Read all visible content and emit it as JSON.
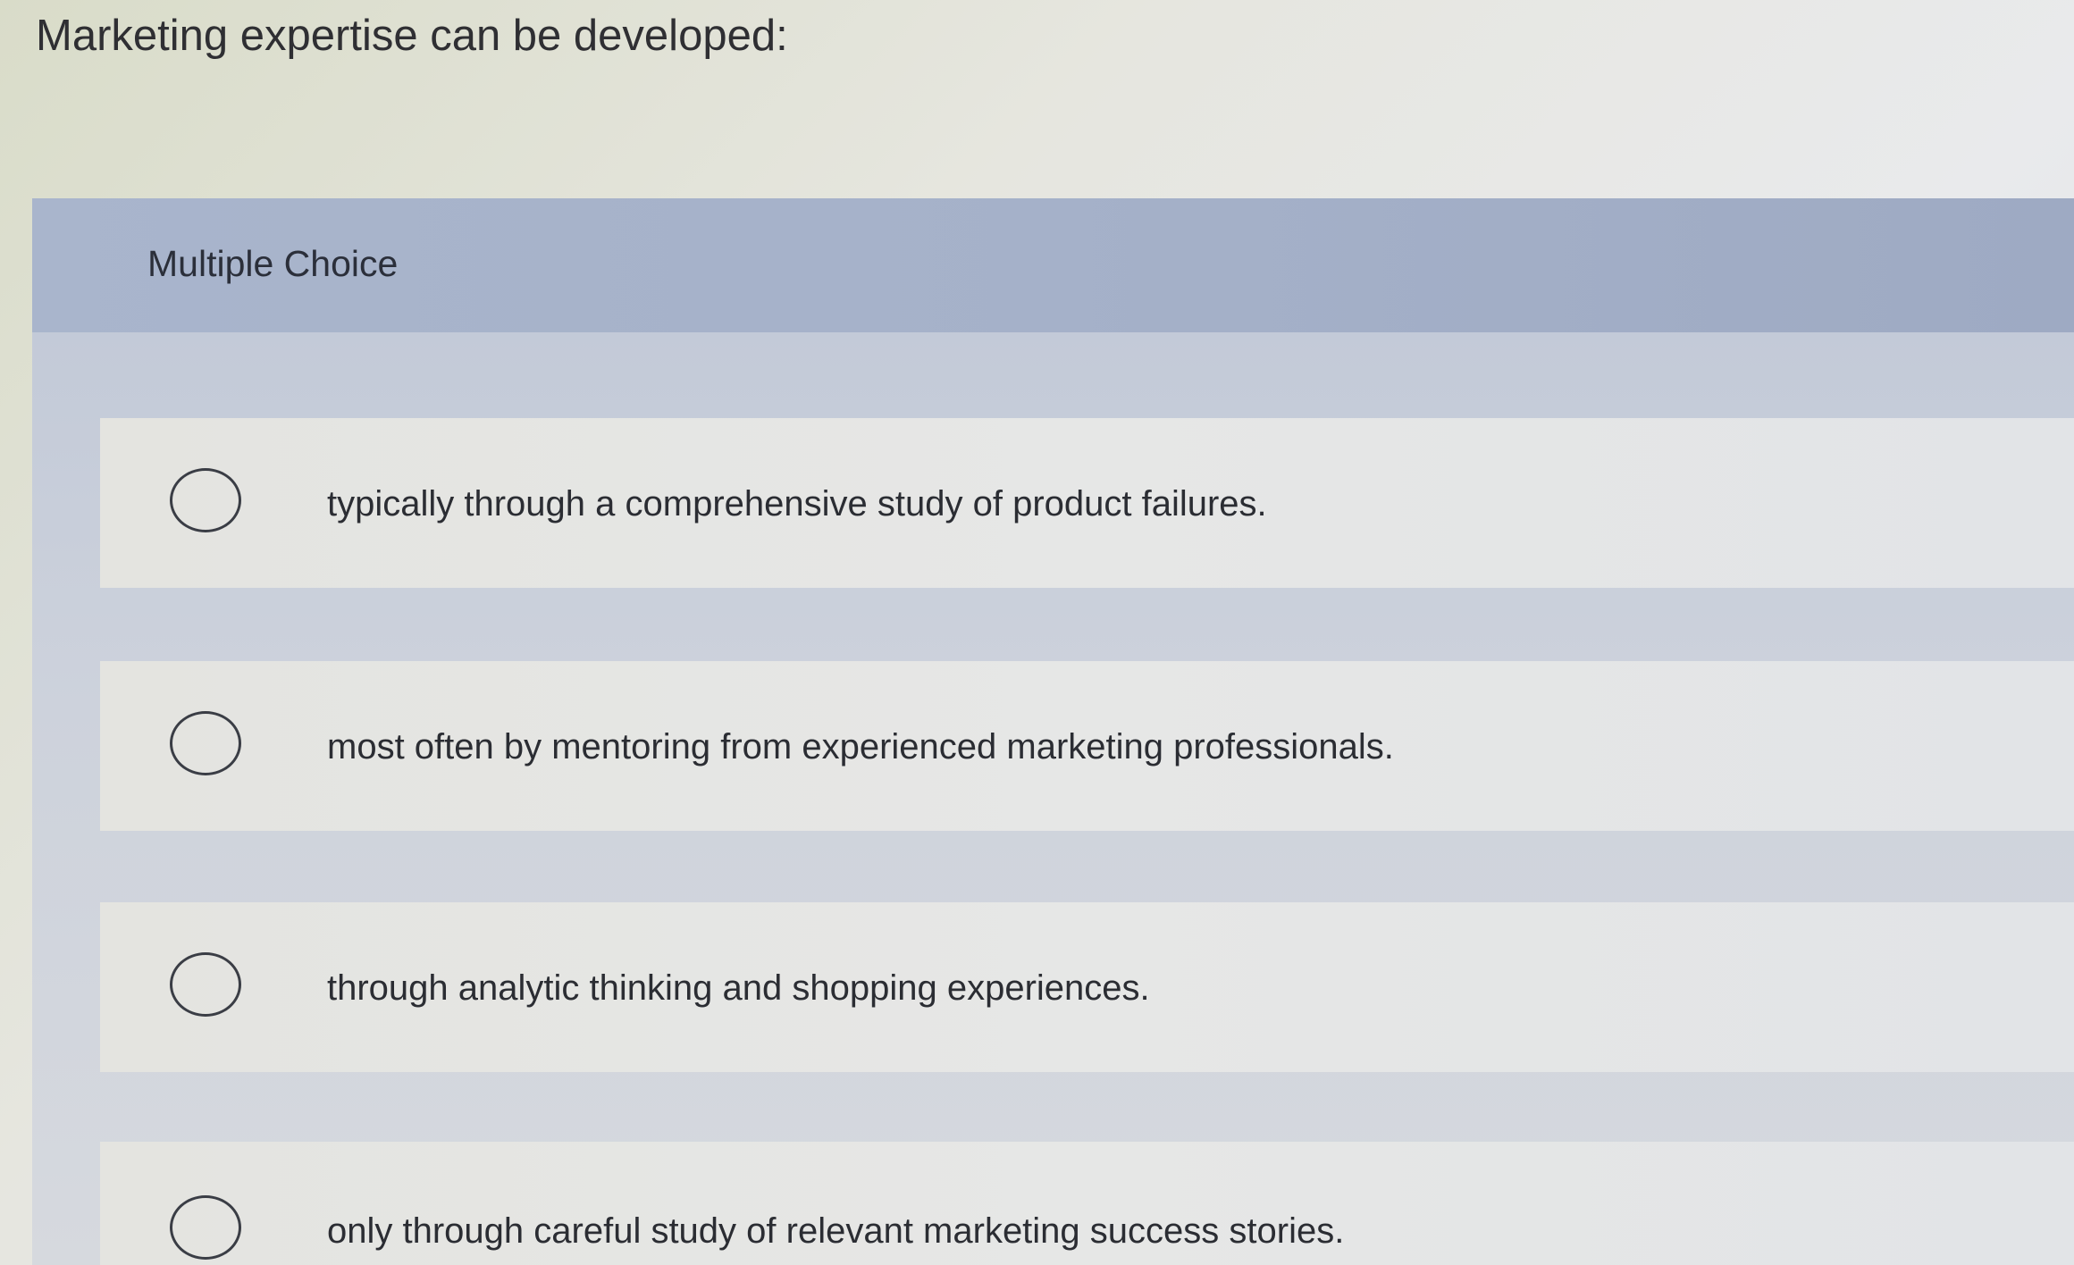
{
  "question": {
    "text": "Marketing expertise can be developed:"
  },
  "section": {
    "label": "Multiple Choice"
  },
  "options": [
    {
      "label": "typically through a comprehensive study of product failures."
    },
    {
      "label": "most often by mentoring from experienced marketing professionals."
    },
    {
      "label": "through analytic thinking and shopping experiences."
    },
    {
      "label": "only through careful study of relevant marketing success stories."
    }
  ],
  "colors": {
    "header_band": "#a5b1c9",
    "option_background": "#e5e6e4",
    "text": "#2b2d33"
  }
}
